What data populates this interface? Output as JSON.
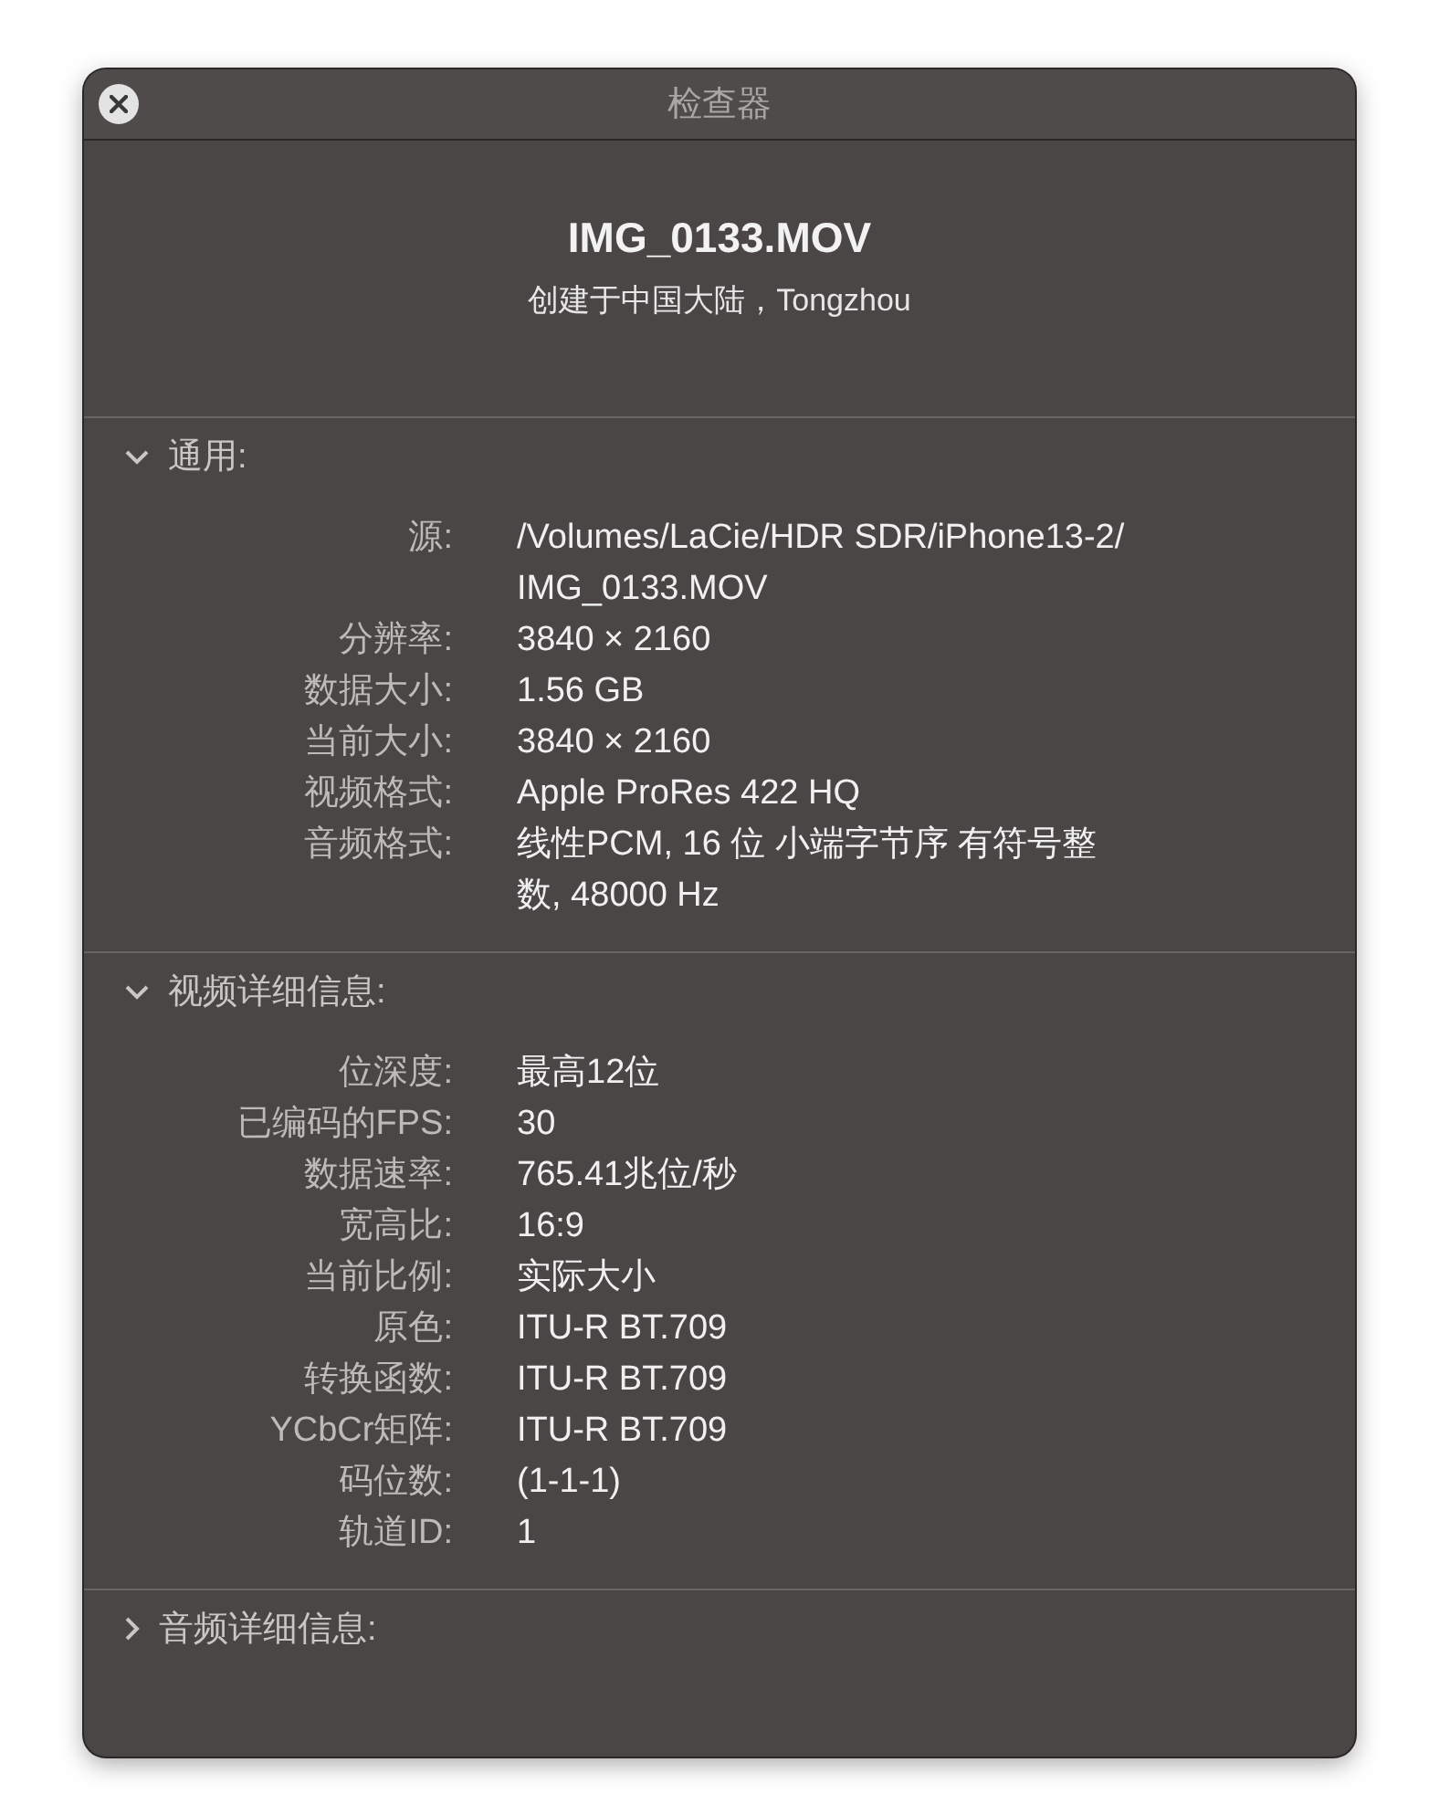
{
  "window": {
    "title": "检查器"
  },
  "header": {
    "filename": "IMG_0133.MOV",
    "subtitle": "创建于中国大陆，Tongzhou"
  },
  "sections": [
    {
      "title": "通用:",
      "expanded": true,
      "rows": [
        {
          "label": "源:",
          "lines": [
            "/Volumes/LaCie/HDR SDR/iPhone13-2/",
            "IMG_0133.MOV"
          ]
        },
        {
          "label": "分辨率:",
          "lines": [
            "3840 × 2160"
          ]
        },
        {
          "label": "数据大小:",
          "lines": [
            "1.56 GB"
          ]
        },
        {
          "label": "当前大小:",
          "lines": [
            "3840 × 2160"
          ]
        },
        {
          "label": "视频格式:",
          "lines": [
            "Apple ProRes 422 HQ"
          ]
        },
        {
          "label": "音频格式:",
          "lines": [
            "线性PCM, 16 位 小端字节序 有符号整",
            "数, 48000 Hz"
          ]
        }
      ]
    },
    {
      "title": "视频详细信息:",
      "expanded": true,
      "rows": [
        {
          "label": "位深度:",
          "lines": [
            "最高12位"
          ]
        },
        {
          "label": "已编码的FPS:",
          "lines": [
            "30"
          ]
        },
        {
          "label": "数据速率:",
          "lines": [
            "765.41兆位/秒"
          ]
        },
        {
          "label": "宽高比:",
          "lines": [
            "16:9"
          ]
        },
        {
          "label": "当前比例:",
          "lines": [
            "实际大小"
          ]
        },
        {
          "label": "原色:",
          "lines": [
            "ITU-R BT.709"
          ]
        },
        {
          "label": "转换函数:",
          "lines": [
            "ITU-R BT.709"
          ]
        },
        {
          "label": "YCbCr矩阵:",
          "lines": [
            "ITU-R BT.709"
          ]
        },
        {
          "label": "码位数:",
          "lines": [
            "(1-1-1)"
          ]
        },
        {
          "label": "轨道ID:",
          "lines": [
            "1"
          ]
        }
      ]
    },
    {
      "title": "音频详细信息:",
      "expanded": false
    }
  ]
}
